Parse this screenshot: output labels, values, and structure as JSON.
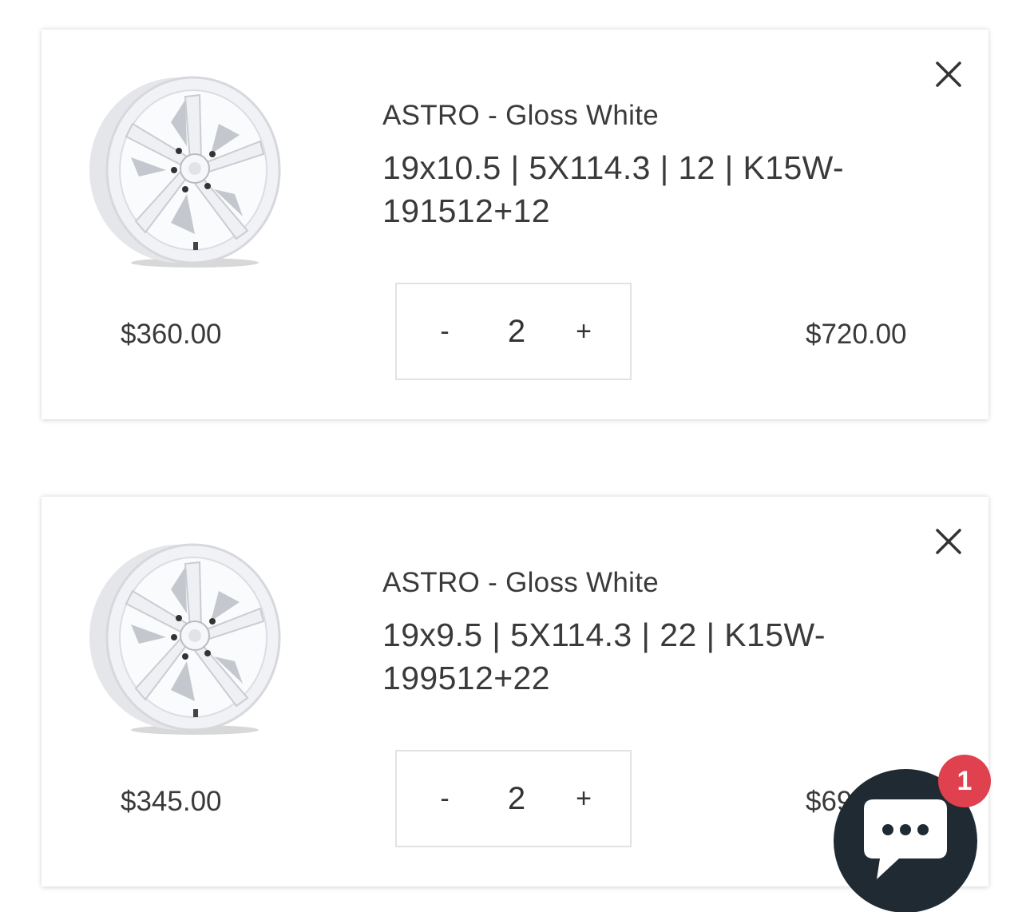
{
  "cart": {
    "items": [
      {
        "title": "ASTRO - Gloss White",
        "variant": "19x10.5 | 5X114.3 | 12 | K15W-191512+12",
        "unit_price": "$360.00",
        "quantity": "2",
        "line_total": "$720.00",
        "minus_label": "-",
        "plus_label": "+"
      },
      {
        "title": "ASTRO - Gloss White",
        "variant": "19x9.5 | 5X114.3 | 22 | K15W-199512+22",
        "unit_price": "$345.00",
        "quantity": "2",
        "line_total": "$69",
        "minus_label": "-",
        "plus_label": "+"
      }
    ]
  },
  "chat": {
    "badge_count": "1",
    "icon": "chat-bubble-icon"
  },
  "colors": {
    "badge": "#e0414f",
    "chat_button": "#1f2a33",
    "text": "#3a3a3a"
  }
}
